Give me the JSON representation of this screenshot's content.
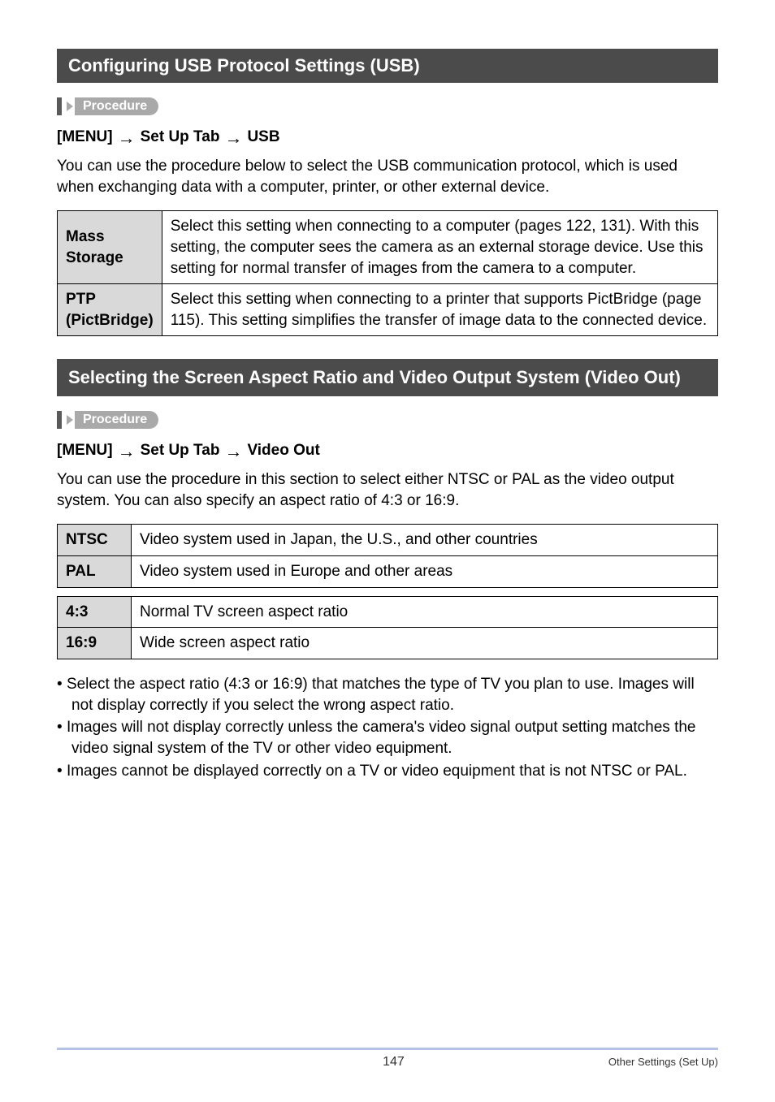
{
  "section1": {
    "title": "Configuring USB Protocol Settings (USB)",
    "procedure_label": "Procedure",
    "menu": {
      "part1": "[MENU]",
      "part2": "Set Up Tab",
      "part3": "USB"
    },
    "intro": "You can use the procedure below to select the USB communication protocol, which is used when exchanging data with a computer, printer, or other external device.",
    "rows": [
      {
        "head": "Mass Storage",
        "body": "Select this setting when connecting to a computer (pages 122, 131). With this setting, the computer sees the camera as an external storage device. Use this setting for normal transfer of images from the camera to a computer."
      },
      {
        "head": "PTP (PictBridge)",
        "body": "Select this setting when connecting to a printer that supports PictBridge (page 115). This setting simplifies the transfer of image data to the connected device."
      }
    ]
  },
  "section2": {
    "title": "Selecting the Screen Aspect Ratio and Video Output System (Video Out)",
    "procedure_label": "Procedure",
    "menu": {
      "part1": "[MENU]",
      "part2": "Set Up Tab",
      "part3": "Video Out"
    },
    "intro": "You can use the procedure in this section to select either NTSC or PAL as the video output system. You can also specify an aspect ratio of 4:3 or 16:9.",
    "systems": [
      {
        "head": "NTSC",
        "body": "Video system used in Japan, the U.S., and other countries"
      },
      {
        "head": "PAL",
        "body": "Video system used in Europe and other areas"
      }
    ],
    "ratios": [
      {
        "head": "4:3",
        "body": "Normal TV screen aspect ratio"
      },
      {
        "head": "16:9",
        "body": "Wide screen aspect ratio"
      }
    ],
    "bullets": [
      "Select the aspect ratio (4:3 or 16:9) that matches the type of TV you plan to use. Images will not display correctly if you select the wrong aspect ratio.",
      "Images will not display correctly unless the camera's video signal output setting matches the video signal system of the TV or other video equipment.",
      "Images cannot be displayed correctly on a TV or video equipment that is not NTSC or PAL."
    ]
  },
  "footer": {
    "page": "147",
    "section": "Other Settings (Set Up)"
  }
}
